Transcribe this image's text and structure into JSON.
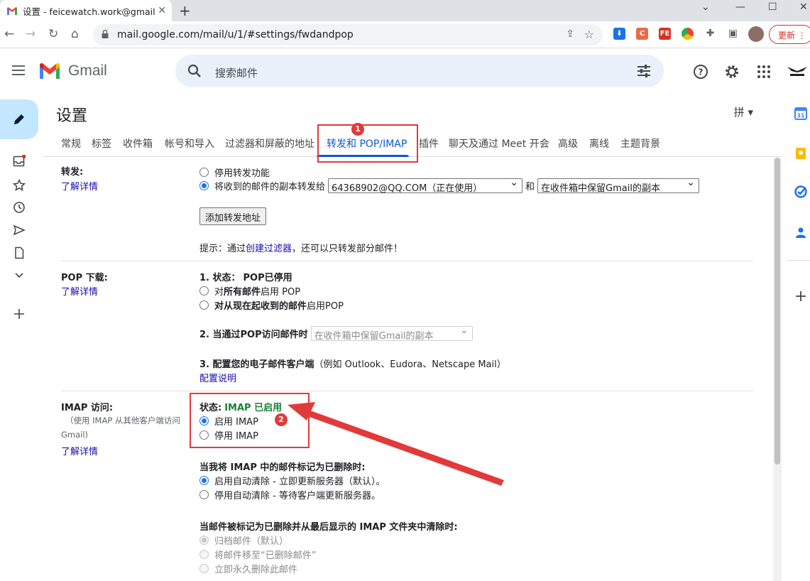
{
  "browser": {
    "tab_title": "设置 - feicewatch.work@gmail",
    "url": "mail.google.com/mail/u/1/#settings/fwdandpop",
    "update_label": "更新"
  },
  "gmail": {
    "brand": "Gmail",
    "search_placeholder": "搜索邮件"
  },
  "settings": {
    "title": "设置",
    "ime": "拼",
    "tabs": [
      "常规",
      "标签",
      "收件箱",
      "帐号和导入",
      "过滤器和屏蔽的地址",
      "转发和 POP/IMAP",
      "插件",
      "聊天及通过 Meet 开会",
      "高级",
      "离线",
      "主题背景"
    ],
    "active_tab": "转发和 POP/IMAP",
    "forwarding": {
      "label": "转发:",
      "learn_more": "了解详情",
      "disable": "停用转发功能",
      "forward_copy": "将收到的邮件的副本转发给",
      "forward_address": "64368902@QQ.COM（正在使用）",
      "and": "和",
      "keep_option": "在收件箱中保留Gmail的副本",
      "add_button": "添加转发地址",
      "tip_prefix": "提示：通过",
      "tip_link": "创建过滤器",
      "tip_suffix": "，还可以只转发部分邮件！"
    },
    "pop": {
      "label": "POP 下载:",
      "learn_more": "了解详情",
      "status_label": "1. 状态：",
      "status_value": "POP已停用",
      "enable_all_pre": "对",
      "enable_all_bold": "所有邮件",
      "enable_all_post": "启用 POP",
      "enable_now_bold": "对从现在起收到的邮件",
      "enable_now_post": "启用POP",
      "when_access": "2. 当通过POP访问邮件时",
      "when_access_select": "在收件箱中保留Gmail的副本",
      "config_bold": "3. 配置您的电子邮件客户端",
      "config_hint": "（例如 Outlook、Eudora、Netscape Mail）",
      "config_link": "配置说明"
    },
    "imap": {
      "label": "IMAP 访问:",
      "sub_label_1": "（使用 IMAP 从其他客户端访问",
      "sub_label_2": "Gmail)",
      "learn_more": "了解详情",
      "status_label": "状态: ",
      "status_value": "IMAP 已启用",
      "enable": "启用 IMAP",
      "disable": "停用 IMAP",
      "deleted_heading": "当我将 IMAP 中的邮件标记为已删除时:",
      "auto_expunge_on": "启用自动清除 - 立即更新服务器（默认）。",
      "auto_expunge_off": "停用自动清除 - 等待客户端更新服务器。",
      "expunge_heading": "当邮件被标记为已删除并从最后显示的 IMAP 文件夹中清除时:",
      "archive": "归档邮件（默认）",
      "move_trash": "将邮件移至“已删除邮件”",
      "delete_forever": "立即永久删除此邮件"
    }
  },
  "annotations": [
    "1",
    "2"
  ],
  "colors": {
    "accent": "#0b57d0",
    "enabled_green": "#188038",
    "annotation_red": "#e23a3a",
    "compose_bg": "#c2e7ff",
    "search_bg": "#eaf1fb"
  }
}
